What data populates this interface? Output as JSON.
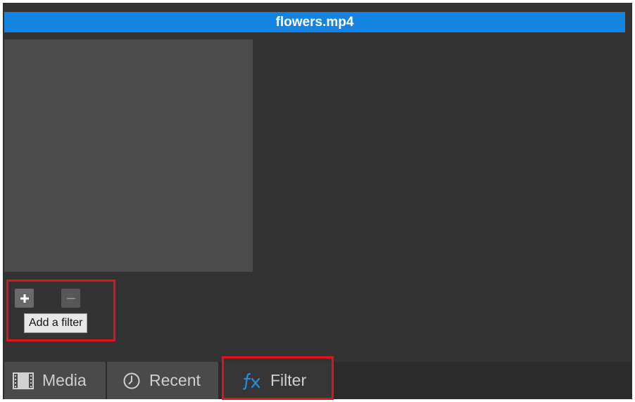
{
  "title_bar": {
    "file_name": "flowers.mp4"
  },
  "filter_controls": {
    "add_icon": "plus-icon",
    "remove_icon": "minus-icon",
    "tooltip": "Add a filter"
  },
  "tabs": [
    {
      "label": "Media",
      "icon": "film-strip-icon"
    },
    {
      "label": "Recent",
      "icon": "clock-icon"
    },
    {
      "label": "Filter",
      "icon": "fx-icon"
    }
  ],
  "colors": {
    "title_bar": "#1483e2",
    "panel_background": "#333333",
    "highlight": "#e0141b",
    "fx_icon": "#1e8fe0"
  }
}
